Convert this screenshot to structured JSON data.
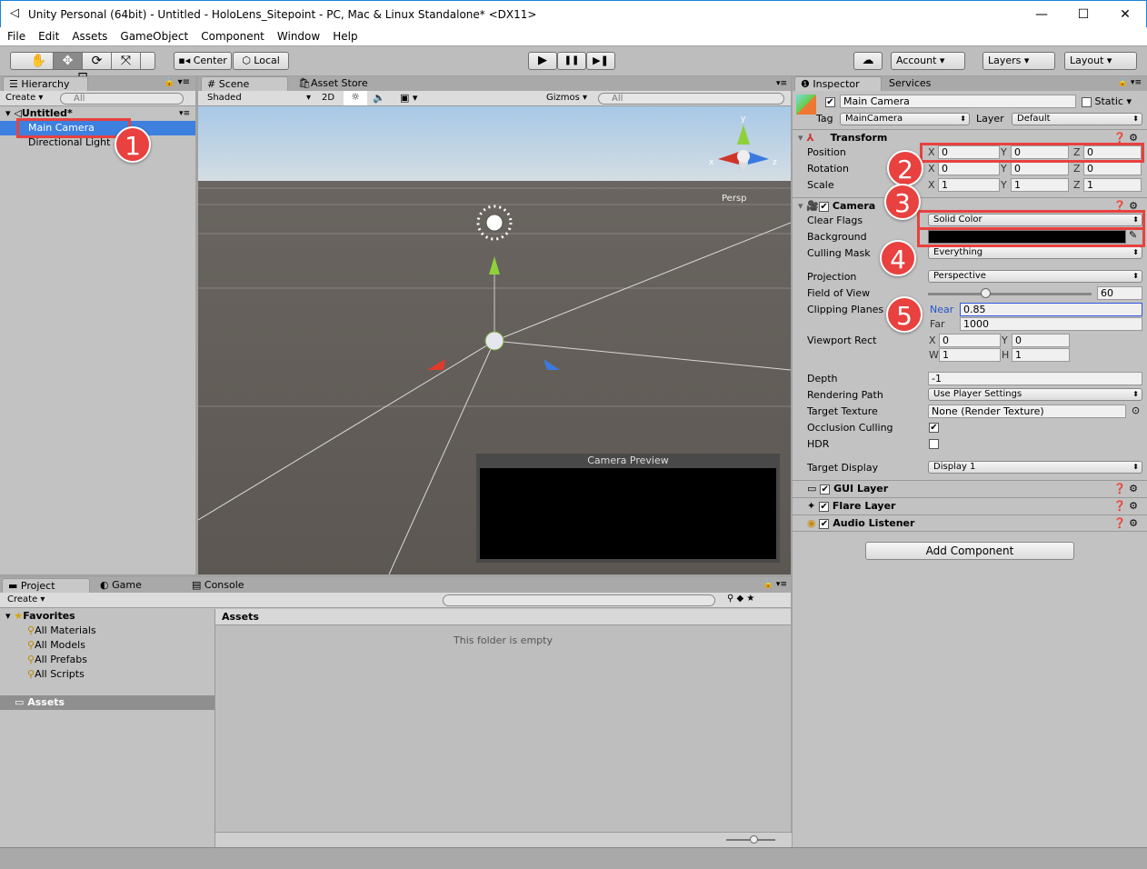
{
  "window": {
    "title": "Unity Personal (64bit) - Untitled - HoloLens_Sitepoint - PC, Mac & Linux Standalone* <DX11>",
    "minimize": "—",
    "maximize": "☐",
    "close": "✕"
  },
  "menu": [
    "File",
    "Edit",
    "Assets",
    "GameObject",
    "Component",
    "Window",
    "Help"
  ],
  "toolbar": {
    "tools": [
      "hand-tool",
      "move-tool",
      "rotate-tool",
      "scale-tool",
      "rect-tool"
    ],
    "tool_glyphs": [
      "✋",
      "✥",
      "⟳",
      "⤧",
      "⊡"
    ],
    "active_tool": "move-tool",
    "pivot": "Center",
    "space": "Local",
    "play": "▶",
    "pause": "❚❚",
    "step": "▶❚",
    "cloud": "☁",
    "account": "Account",
    "layers": "Layers",
    "layout": "Layout"
  },
  "hierarchy": {
    "tab": "Hierarchy",
    "create": "Create",
    "search_placeholder": "All",
    "scene": "Untitled*",
    "items": [
      "Main Camera",
      "Directional Light"
    ],
    "selected": "Main Camera"
  },
  "scene": {
    "tabs": [
      "Scene",
      "Asset Store"
    ],
    "shading": "Shaded",
    "mode2d": "2D",
    "gizmos": "Gizmos",
    "search_placeholder": "All",
    "persp": "Persp",
    "preview_title": "Camera Preview",
    "axis_x": "x",
    "axis_y": "y",
    "axis_z": "z"
  },
  "inspector": {
    "tabs": [
      "Inspector",
      "Services"
    ],
    "object_name": "Main Camera",
    "static": "Static",
    "tag_label": "Tag",
    "tag": "MainCamera",
    "layer_label": "Layer",
    "layer": "Default",
    "transform": {
      "title": "Transform",
      "rows": [
        {
          "label": "Position",
          "x": "0",
          "y": "0",
          "z": "0"
        },
        {
          "label": "Rotation",
          "x": "0",
          "y": "0",
          "z": "0"
        },
        {
          "label": "Scale",
          "x": "1",
          "y": "1",
          "z": "1"
        }
      ]
    },
    "camera": {
      "title": "Camera",
      "clear_flags_label": "Clear Flags",
      "clear_flags": "Solid Color",
      "background_label": "Background",
      "background_color": "#000000",
      "culling_mask_label": "Culling Mask",
      "culling_mask": "Everything",
      "projection_label": "Projection",
      "projection": "Perspective",
      "fov_label": "Field of View",
      "fov": "60",
      "fov_fraction": 0.35,
      "clipping_label": "Clipping Planes",
      "near_label": "Near",
      "near": "0.85",
      "far_label": "Far",
      "far": "1000",
      "viewport_label": "Viewport Rect",
      "vx": "0",
      "vy": "0",
      "vw": "1",
      "vh": "1",
      "depth_label": "Depth",
      "depth": "-1",
      "rendering_path_label": "Rendering Path",
      "rendering_path": "Use Player Settings",
      "target_texture_label": "Target Texture",
      "target_texture": "None (Render Texture)",
      "occlusion_label": "Occlusion Culling",
      "occlusion": true,
      "hdr_label": "HDR",
      "hdr": false,
      "target_display_label": "Target Display",
      "target_display": "Display 1"
    },
    "components": [
      "GUI Layer",
      "Flare Layer",
      "Audio Listener"
    ],
    "add_component": "Add Component"
  },
  "project": {
    "tabs": [
      "Project",
      "Game",
      "Console"
    ],
    "create": "Create",
    "favorites": "Favorites",
    "favorite_items": [
      "All Materials",
      "All Models",
      "All Prefabs",
      "All Scripts"
    ],
    "assets": "Assets",
    "breadcrumb": "Assets",
    "empty": "This folder is empty"
  },
  "annotations": [
    "1",
    "2",
    "3",
    "4",
    "5"
  ],
  "colors": {
    "highlight": "#e8413f",
    "selection": "#3d80df"
  }
}
